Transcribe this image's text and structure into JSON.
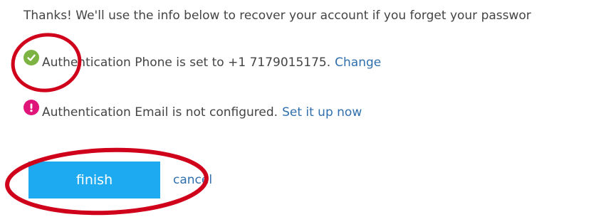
{
  "intro_text": "Thanks! We'll use the info below to recover your account if you forget your passwor",
  "phone": {
    "icon": "check-circle-icon",
    "status_text": "Authentication Phone is set to +1 7179015175.",
    "link_label": "Change"
  },
  "email": {
    "icon": "exclamation-circle-icon",
    "status_text": "Authentication Email is not configured.",
    "link_label": "Set it up now"
  },
  "actions": {
    "finish_label": "finish",
    "cancel_label": "cancel"
  },
  "colors": {
    "accent": "#1eaaf1",
    "link": "#2f6fad",
    "success": "#7cb342",
    "error": "#e0157a",
    "annotation": "#d0021b"
  }
}
